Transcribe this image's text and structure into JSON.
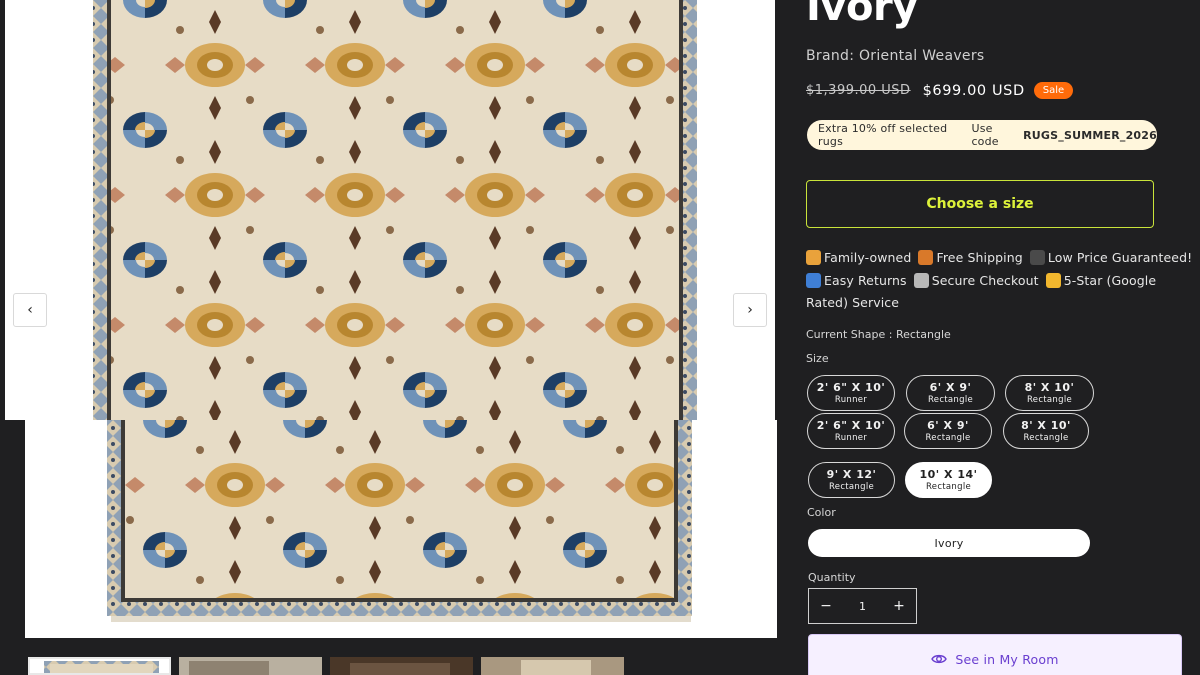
{
  "product": {
    "title": "Ivory",
    "brand": "Brand: Oriental Weavers",
    "price_original": "$1,399.00 USD",
    "price_sale": "$699.00 USD",
    "sale_badge": "Sale"
  },
  "gallery": {
    "prev_icon": "‹",
    "next_icon": "›"
  },
  "promo": {
    "text": "Extra 10% off selected rugs",
    "code_prefix": "Use code",
    "code": "RUGS_SUMMER_2026"
  },
  "choose_size_label": "Choose a size",
  "trust_badges": [
    {
      "icon": "family-icon",
      "label": "Family-owned"
    },
    {
      "icon": "truck-icon",
      "label": "Free Shipping"
    },
    {
      "icon": "dollar-icon",
      "label": "Low Price Guaranteed!"
    },
    {
      "icon": "return-icon",
      "label": "Easy Returns"
    },
    {
      "icon": "shield-icon",
      "label": "Secure Checkout"
    },
    {
      "icon": "star-icon",
      "label": "5-Star (Google Rated) Service"
    }
  ],
  "shape": {
    "label": "Current Shape",
    "separator": " : ",
    "value": "Rectangle"
  },
  "size": {
    "label": "Size",
    "options": [
      {
        "dims": "2' 6\" X 10'",
        "shape": "Runner",
        "selected": false
      },
      {
        "dims": "6' X 9'",
        "shape": "Rectangle",
        "selected": false
      },
      {
        "dims": "8' X 10'",
        "shape": "Rectangle",
        "selected": false
      },
      {
        "dims": "2' 6\" X 10'",
        "shape": "Runner",
        "selected": false
      },
      {
        "dims": "6' X 9'",
        "shape": "Rectangle",
        "selected": false
      },
      {
        "dims": "8' X 10'",
        "shape": "Rectangle",
        "selected": false
      },
      {
        "dims": "9' X 12'",
        "shape": "Rectangle",
        "selected": false
      },
      {
        "dims": "10' X 14'",
        "shape": "Rectangle",
        "selected": true
      }
    ]
  },
  "color": {
    "label": "Color",
    "selected": "Ivory"
  },
  "quantity": {
    "label": "Quantity",
    "value": "1",
    "minus": "−",
    "plus": "+"
  },
  "room_button_label": "See in My Room",
  "colors": {
    "background": "#1f1f21",
    "accent_lime": "#ddf23a",
    "sale_orange": "#ff6b0a",
    "promo_bg": "#fff6dc",
    "room_purple": "#6a3fd0"
  }
}
